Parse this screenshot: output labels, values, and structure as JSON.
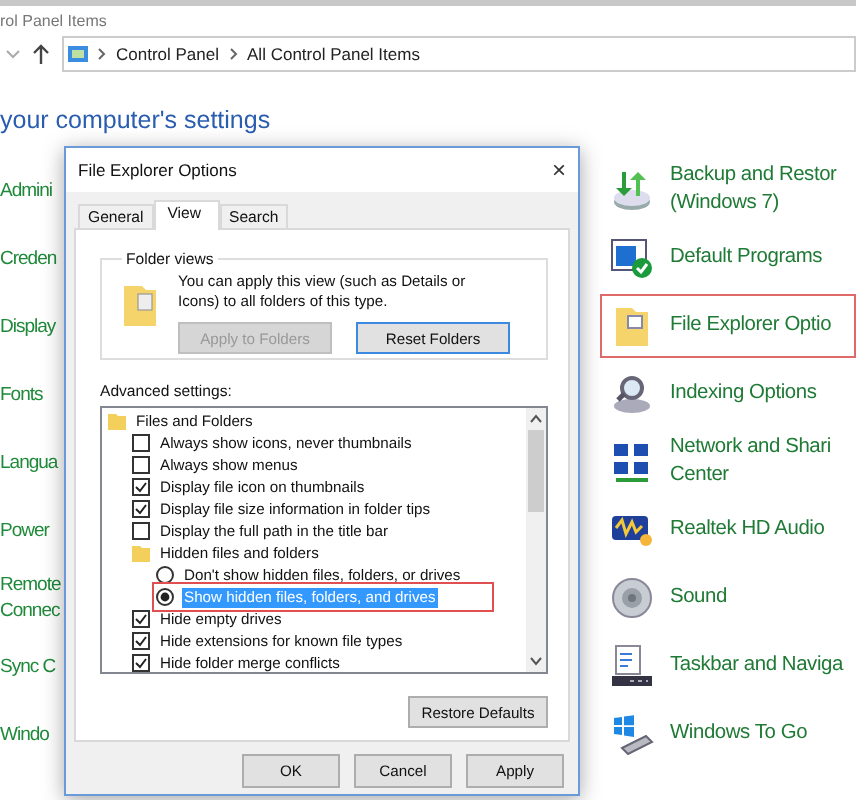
{
  "window": {
    "title": "rol Panel Items"
  },
  "address_bar": {
    "crumbs": [
      "Control Panel",
      "All Control Panel Items"
    ]
  },
  "heading": "your computer's settings",
  "left_items": [
    {
      "lines": [
        "Admini"
      ]
    },
    {
      "lines": [
        "Creden"
      ]
    },
    {
      "lines": [
        "Display"
      ]
    },
    {
      "lines": [
        "Fonts"
      ]
    },
    {
      "lines": [
        "Langua"
      ]
    },
    {
      "lines": [
        "Power"
      ]
    },
    {
      "lines": [
        "Remote",
        "Connec"
      ]
    },
    {
      "lines": [
        "Sync C"
      ]
    },
    {
      "lines": [
        "Windo"
      ]
    }
  ],
  "right_items": [
    {
      "kind": "backup",
      "lines": [
        "Backup and Restor",
        "(Windows 7)"
      ],
      "highlighted": false
    },
    {
      "kind": "programs",
      "lines": [
        "Default Programs"
      ],
      "highlighted": false
    },
    {
      "kind": "folder",
      "lines": [
        "File Explorer Optio"
      ],
      "highlighted": true
    },
    {
      "kind": "search",
      "lines": [
        "Indexing Options"
      ],
      "highlighted": false
    },
    {
      "kind": "network",
      "lines": [
        "Network and Shari",
        "Center"
      ],
      "highlighted": false
    },
    {
      "kind": "audio",
      "lines": [
        "Realtek HD Audio"
      ],
      "highlighted": false
    },
    {
      "kind": "sound",
      "lines": [
        "Sound"
      ],
      "highlighted": false
    },
    {
      "kind": "taskbar",
      "lines": [
        "Taskbar and Naviga"
      ],
      "highlighted": false
    },
    {
      "kind": "usb",
      "lines": [
        "Windows To Go"
      ],
      "highlighted": false
    }
  ],
  "dialog": {
    "title": "File Explorer Options",
    "close": "×",
    "tabs": [
      {
        "label": "General",
        "selected": false
      },
      {
        "label": "View",
        "selected": true
      },
      {
        "label": "Search",
        "selected": false
      }
    ],
    "folder_views": {
      "legend": "Folder views",
      "description": "You can apply this view (such as Details or Icons) to all folders of this type.",
      "buttons": [
        {
          "label": "Apply to Folders",
          "disabled": true
        },
        {
          "label": "Reset Folders",
          "disabled": false
        }
      ]
    },
    "advanced": {
      "label": "Advanced settings:",
      "tree": [
        {
          "kind": "folder",
          "label": "Files and Folders",
          "selected": false,
          "highlighted": false,
          "children": [
            {
              "kind": "checkbox",
              "label": "Always show icons, never thumbnails",
              "checked": false,
              "selected": false,
              "highlighted": false
            },
            {
              "kind": "checkbox",
              "label": "Always show menus",
              "checked": false,
              "selected": false,
              "highlighted": false
            },
            {
              "kind": "checkbox",
              "label": "Display file icon on thumbnails",
              "checked": true,
              "selected": false,
              "highlighted": false
            },
            {
              "kind": "checkbox",
              "label": "Display file size information in folder tips",
              "checked": true,
              "selected": false,
              "highlighted": false
            },
            {
              "kind": "checkbox",
              "label": "Display the full path in the title bar",
              "checked": false,
              "selected": false,
              "highlighted": false
            },
            {
              "kind": "folder",
              "label": "Hidden files and folders",
              "selected": false,
              "highlighted": false,
              "children": [
                {
                  "kind": "radio",
                  "label": "Don't show hidden files, folders, or drives",
                  "checked": false,
                  "selected": false,
                  "highlighted": false
                },
                {
                  "kind": "radio",
                  "label": "Show hidden files, folders, and drives",
                  "checked": true,
                  "selected": true,
                  "highlighted": true
                }
              ]
            },
            {
              "kind": "checkbox",
              "label": "Hide empty drives",
              "checked": true,
              "selected": false,
              "highlighted": false
            },
            {
              "kind": "checkbox",
              "label": "Hide extensions for known file types",
              "checked": true,
              "selected": false,
              "highlighted": false
            },
            {
              "kind": "checkbox",
              "label": "Hide folder merge conflicts",
              "checked": true,
              "selected": false,
              "highlighted": false
            }
          ]
        }
      ]
    },
    "restore_button": "Restore Defaults",
    "buttons": [
      "OK",
      "Cancel",
      "Apply"
    ]
  }
}
